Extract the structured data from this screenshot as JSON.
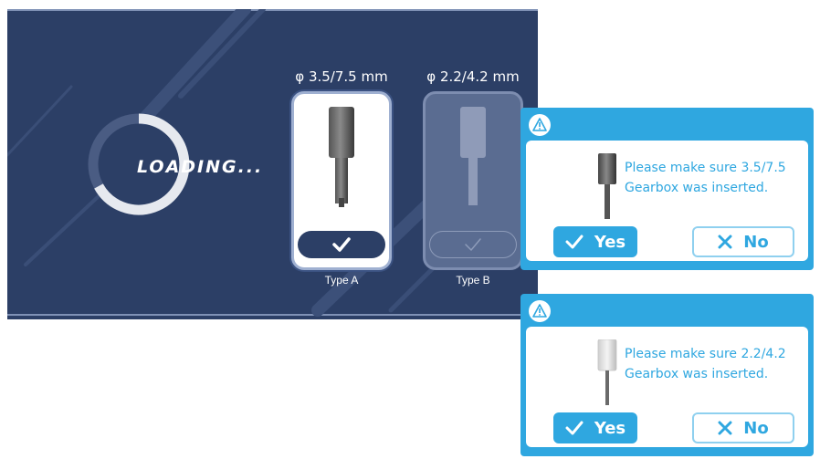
{
  "loading": {
    "text": "LOADING..."
  },
  "gearbox_options": [
    {
      "size": "φ 3.5/7.5 mm",
      "type_label": "Type A",
      "selected": true
    },
    {
      "size": "φ 2.2/4.2 mm",
      "type_label": "Type B",
      "selected": false
    }
  ],
  "dialogs": [
    {
      "icon": "warning-icon",
      "message_line1": "Please make sure 3.5/7.5",
      "message_line2": "Gearbox was inserted.",
      "yes_label": "Yes",
      "no_label": "No",
      "tool_color": "dark"
    },
    {
      "icon": "warning-icon",
      "message_line1": "Please make sure 2.2/4.2",
      "message_line2": "Gearbox was inserted.",
      "yes_label": "Yes",
      "no_label": "No",
      "tool_color": "light"
    }
  ],
  "colors": {
    "panel_bg": "#2c3f66",
    "dialog_accent": "#2fa7e0",
    "white": "#ffffff"
  }
}
